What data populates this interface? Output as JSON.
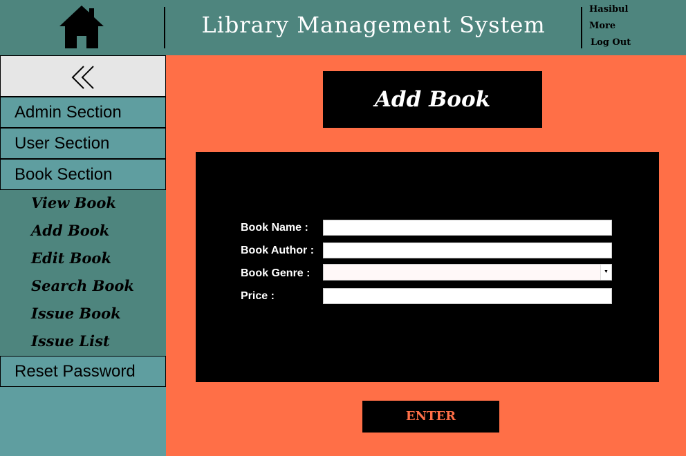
{
  "header": {
    "title": "Library Management System",
    "home_icon": "home-icon",
    "user_menu": [
      "Hasibul",
      "More",
      "Log Out"
    ]
  },
  "sidebar": {
    "collapse_icon": "double-chevron-left-icon",
    "items": [
      {
        "label": "Admin Section"
      },
      {
        "label": "User Section"
      },
      {
        "label": "Book Section"
      }
    ],
    "sub_items": [
      {
        "label": "View Book"
      },
      {
        "label": "Add Book"
      },
      {
        "label": "Edit Book"
      },
      {
        "label": "Search Book"
      },
      {
        "label": "Issue Book"
      },
      {
        "label": "Issue List"
      }
    ],
    "reset": {
      "label": "Reset Password"
    }
  },
  "main": {
    "title": "Add Book",
    "fields": [
      {
        "label": "Book Name :",
        "value": ""
      },
      {
        "label": "Book Author :",
        "value": ""
      },
      {
        "label": "Book Genre :",
        "value": ""
      },
      {
        "label": "Price :",
        "value": ""
      }
    ],
    "enter_label": "ENTER"
  },
  "colors": {
    "header_bg": "#4e857e",
    "sidebar_bg": "#5f9ea0",
    "main_bg": "#ff6f47",
    "panel_bg": "#000000"
  }
}
